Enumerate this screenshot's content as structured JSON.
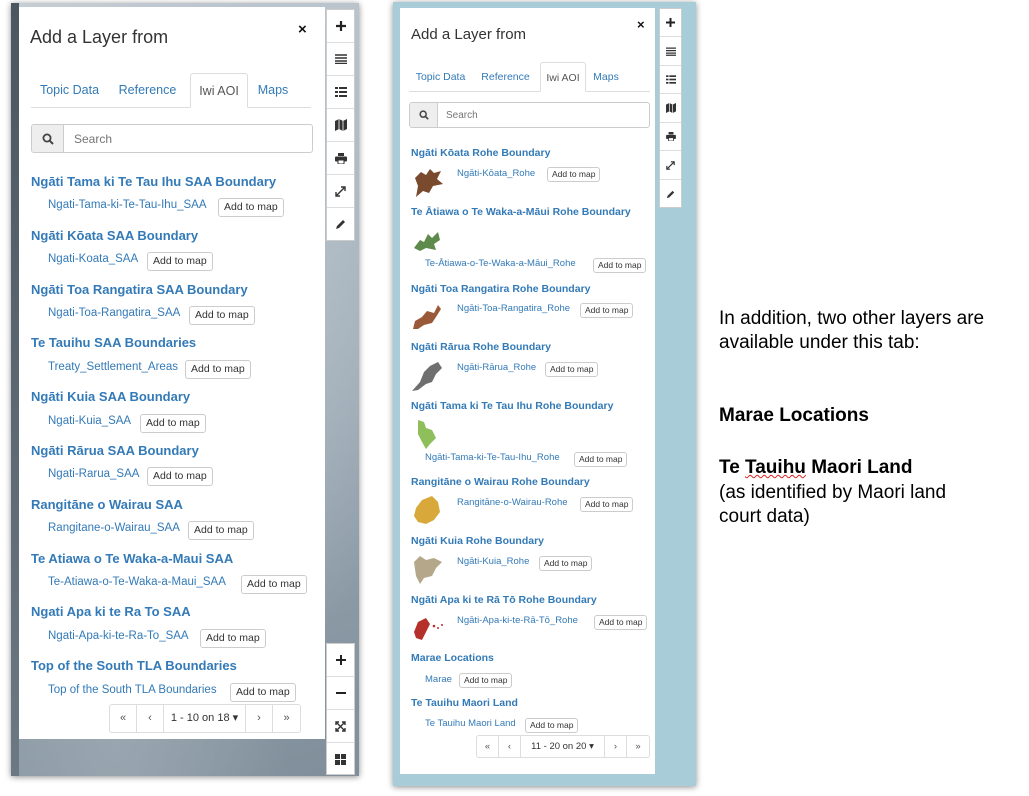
{
  "left_panel": {
    "title": "Add a Layer from",
    "close": "×",
    "tabs": [
      "Topic Data",
      "Reference",
      "Iwi AOI",
      "Maps"
    ],
    "active_tab": "Iwi AOI",
    "search_placeholder": "Search",
    "layers": [
      {
        "title": "Ngāti Tama ki Te Tau Ihu SAA Boundary",
        "name": "Ngati-Tama-ki-Te-Tau-Ihu_SAA",
        "button": "Add to map"
      },
      {
        "title": "Ngāti Kōata SAA Boundary",
        "name": "Ngati-Koata_SAA",
        "button": "Add to map"
      },
      {
        "title": "Ngāti Toa Rangatira SAA Boundary",
        "name": "Ngati-Toa-Rangatira_SAA",
        "button": "Add to map"
      },
      {
        "title": "Te Tauihu SAA Boundaries",
        "name": "Treaty_Settlement_Areas",
        "button": "Add to map"
      },
      {
        "title": "Ngāti Kuia SAA Boundary",
        "name": "Ngati-Kuia_SAA",
        "button": "Add to map"
      },
      {
        "title": "Ngāti Rārua SAA Boundary",
        "name": "Ngati-Rarua_SAA",
        "button": "Add to map"
      },
      {
        "title": "Rangitāne o Wairau SAA",
        "name": "Rangitane-o-Wairau_SAA",
        "button": "Add to map"
      },
      {
        "title": "Te Atiawa o Te Waka-a-Maui SAA",
        "name": "Te-Atiawa-o-Te-Waka-a-Maui_SAA",
        "button": "Add to map"
      },
      {
        "title": "Ngati Apa ki te Ra To SAA",
        "name": "Ngati-Apa-ki-te-Ra-To_SAA",
        "button": "Add to map"
      },
      {
        "title": "Top of the South TLA Boundaries",
        "name": "Top of the South TLA Boundaries",
        "button": "Add to map"
      }
    ],
    "pagination": {
      "first": "«",
      "prev": "‹",
      "info": "1 - 10 on 18 ▾",
      "next": "›",
      "last": "»"
    },
    "toolbar_top": [
      "plus-icon",
      "layers-list-icon",
      "list-icon",
      "map-icon",
      "print-icon",
      "expand-icon",
      "pencil-icon"
    ],
    "toolbar_bottom": [
      "zoom-in-icon",
      "zoom-out-icon",
      "fullscreen-icon",
      "grid-icon"
    ]
  },
  "right_panel": {
    "title": "Add a Layer from",
    "close": "×",
    "tabs": [
      "Topic Data",
      "Reference",
      "Iwi AOI",
      "Maps"
    ],
    "active_tab": "Iwi AOI",
    "search_placeholder": "Search",
    "layers": [
      {
        "title": "Ngāti Kōata Rohe Boundary",
        "name": "Ngāti-Kōata_Rohe",
        "button": "Add to map",
        "thumb_color": "#7a4a2e"
      },
      {
        "title": "Te Ātiawa o Te Waka-a-Māui Rohe Boundary",
        "name": "Te-Ātiawa-o-Te-Waka-a-Māui_Rohe",
        "button": "Add to map",
        "thumb_color": "#5e8a4c"
      },
      {
        "title": "Ngāti Toa Rangatira Rohe Boundary",
        "name": "Ngāti-Toa-Rangatira_Rohe",
        "button": "Add to map",
        "thumb_color": "#9a5a3a"
      },
      {
        "title": "Ngāti Rārua Rohe Boundary",
        "name": "Ngāti-Rārua_Rohe",
        "button": "Add to map",
        "thumb_color": "#6f6f6f"
      },
      {
        "title": "Ngāti Tama ki Te Tau Ihu Rohe Boundary",
        "name": "Ngāti-Tama-ki-Te-Tau-Ihu_Rohe",
        "button": "Add to map",
        "thumb_color": "#8fbf5a"
      },
      {
        "title": "Rangitāne o Wairau Rohe Boundary",
        "name": "Rangitāne-o-Wairau-Rohe",
        "button": "Add to map",
        "thumb_color": "#d9a83a"
      },
      {
        "title": "Ngāti Kuia Rohe Boundary",
        "name": "Ngāti-Kuia_Rohe",
        "button": "Add to map",
        "thumb_color": "#b5a88a"
      },
      {
        "title": "Ngāti Apa ki te Rā Tō Rohe Boundary",
        "name": "Ngāti-Apa-ki-te-Rā-Tō_Rohe",
        "button": "Add to map",
        "thumb_color": "#b5302a"
      },
      {
        "title": "Marae Locations",
        "name": "Marae",
        "button": "Add to map"
      },
      {
        "title": "Te Tauihu Maori Land",
        "name": "Te Tauihu Maori Land",
        "button": "Add to map"
      }
    ],
    "pagination": {
      "first": "«",
      "prev": "‹",
      "info": "11 - 20 on 20 ▾",
      "next": "›",
      "last": "»"
    },
    "toolbar": [
      "plus-icon",
      "layers-list-icon",
      "list-icon",
      "map-icon",
      "print-icon",
      "expand-icon",
      "pencil-icon"
    ]
  },
  "annotation": {
    "intro": "In addition, two other layers are available under this tab:",
    "layer1": "Marae Locations",
    "layer2_word1": "Te",
    "layer2_word2": "Tauihu",
    "layer2_rest": "Maori Land",
    "layer2_note": "(as identified by Maori land court data)"
  }
}
